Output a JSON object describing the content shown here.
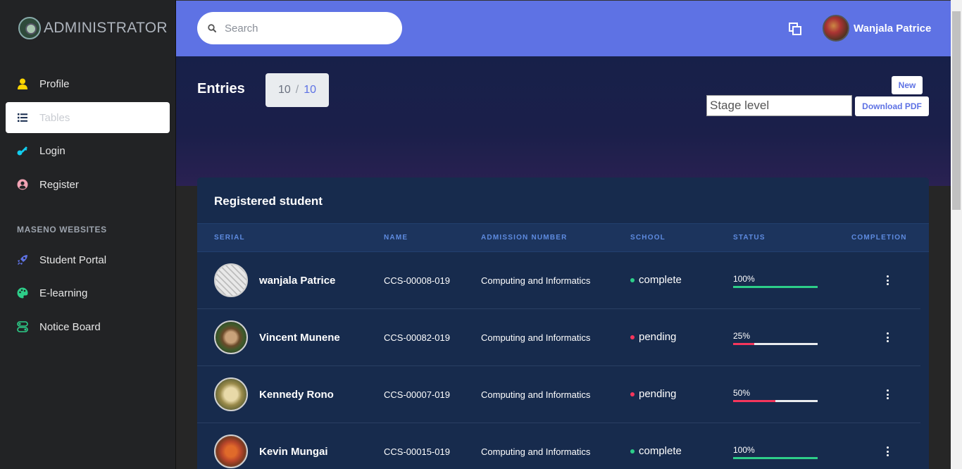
{
  "sidebar": {
    "brand": "ADMINISTRATOR",
    "items": [
      {
        "label": "Profile",
        "icon": "user-icon",
        "color": "#ffd600"
      },
      {
        "label": "Tables",
        "icon": "list-icon",
        "color": "#172b4d",
        "active": true
      },
      {
        "label": "Login",
        "icon": "key-icon",
        "color": "#11cdef"
      },
      {
        "label": "Register",
        "icon": "user-circle-icon",
        "color": "#f3a4b5"
      }
    ],
    "section_heading": "MASENO WEBSITES",
    "links": [
      {
        "label": "Student Portal",
        "icon": "rocket-icon",
        "color": "#5e72e4"
      },
      {
        "label": "E-learning",
        "icon": "palette-icon",
        "color": "#2dce89"
      },
      {
        "label": "Notice Board",
        "icon": "ui-icon",
        "color": "#2dce89"
      }
    ]
  },
  "topbar": {
    "search_placeholder": "Search",
    "user_name": "Wanjala Patrice"
  },
  "header": {
    "entries_title": "Entries",
    "entries_current": "10",
    "entries_separator": "/",
    "entries_total": "10",
    "new_label": "New",
    "stage_placeholder": "Stage level",
    "pdf_label": "Download PDF"
  },
  "table": {
    "title": "Registered student",
    "columns": [
      "SERIAL",
      "NAME",
      "ADMISSION NUMBER",
      "SCHOOL",
      "STATUS",
      "COMPLETION"
    ],
    "rows": [
      {
        "name": "wanjala Patrice",
        "admission": "CCS-00008-019",
        "school": "Computing and Informatics",
        "status": "complete",
        "progress": "100%",
        "progress_value": 100,
        "status_color": "#2dce89"
      },
      {
        "name": "Vincent Munene",
        "admission": "CCS-00082-019",
        "school": "Computing and Informatics",
        "status": "pending",
        "progress": "25%",
        "progress_value": 25,
        "status_color": "#f5365c"
      },
      {
        "name": "Kennedy Rono",
        "admission": "CCS-00007-019",
        "school": "Computing and Informatics",
        "status": "pending",
        "progress": "50%",
        "progress_value": 50,
        "status_color": "#f5365c"
      },
      {
        "name": "Kevin Mungai",
        "admission": "CCS-00015-019",
        "school": "Computing and Informatics",
        "status": "complete",
        "progress": "100%",
        "progress_value": 100,
        "status_color": "#2dce89"
      }
    ]
  },
  "colors": {
    "primary": "#5e72e4",
    "success": "#2dce89",
    "danger": "#f5365c",
    "card": "#172b4d"
  }
}
